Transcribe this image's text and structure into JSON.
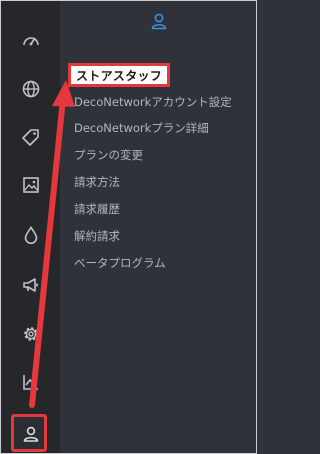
{
  "colors": {
    "rail_bg": "#25272b",
    "panel_bg": "#2f3238",
    "icon": "#bfc3c9",
    "accent_blue": "#3d8fe0",
    "highlight_red": "#e4383e"
  },
  "rail": {
    "items": [
      {
        "icon": "dashboard-icon"
      },
      {
        "icon": "globe-icon"
      },
      {
        "icon": "tag-icon"
      },
      {
        "icon": "image-icon"
      },
      {
        "icon": "droplet-icon"
      },
      {
        "icon": "megaphone-icon"
      },
      {
        "icon": "settings-gear-icon"
      },
      {
        "icon": "chart-icon"
      },
      {
        "icon": "user-icon",
        "active": true
      }
    ]
  },
  "panel": {
    "header_icon": "user-icon",
    "title": "ストアスタッフ",
    "items": [
      "DecoNetworkアカウント設定",
      "DecoNetworkプラン詳細",
      "プランの変更",
      "請求方法",
      "請求履歴",
      "解約請求",
      "ベータプログラム"
    ]
  }
}
